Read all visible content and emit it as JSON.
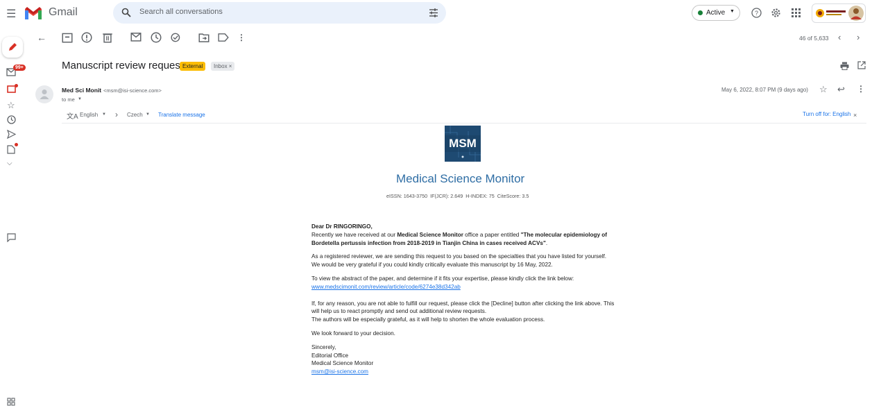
{
  "app": {
    "name": "Gmail"
  },
  "search": {
    "placeholder": "Search all conversations"
  },
  "status": {
    "label": "Active"
  },
  "toolbar": {
    "count": "46 of 5,633"
  },
  "rail": {
    "inbox_badge": "99+"
  },
  "message": {
    "subject": "Manuscript review request",
    "labels": [
      {
        "text": "External",
        "color": "#fbbc04"
      },
      {
        "text": "Inbox ×",
        "color": "#dadce0"
      }
    ],
    "sender_name": "Med Sci Monit",
    "sender_email": "<msm@isi-science.com>",
    "to": "to me",
    "date": "May 6, 2022, 8:07 PM (9 days ago)"
  },
  "translate": {
    "from": "English",
    "to": "Czech",
    "action": "Translate message",
    "turn_off": "Turn off for: English"
  },
  "journal": {
    "logo_text": "MSM",
    "name": "Medical Science Monitor",
    "metrics": "eISSN: 1643-3750  IF(JCR): 2.649  H-INDEX: 75  CiteScore: 3.5"
  },
  "body": {
    "greeting": "Dear Dr RINGORINGO,",
    "p1_a": "Recently we have received at our ",
    "p1_b": "Medical Science Monitor",
    "p1_c": " office a paper entitled ",
    "p1_d": "\"The molecular epidemiology of Bordetella pertussis infection from 2018-2019 in Tianjin China in cases received ACVs\"",
    "p1_e": ".",
    "p2_a": "As a registered reviewer, we are sending this request to you based on the specialties that you have listed for yourself.",
    "p2_b": "We would be very grateful if you could kindly critically evaluate this manuscript by 16 May, 2022.",
    "p3": "To view the abstract of the paper, and determine if it fits your expertise, please kindly click the link below:",
    "link": "www.medscimonit.com/review/article/code/6274e38d342ab",
    "p4_a": "If, for any reason, you are not able to fulfill our request, please click the [Decline] button after clicking the link above. This will help us to react promptly and send out additional review requests.",
    "p4_b": "The authors will be especially grateful, as it will help to shorten the whole evaluation process.",
    "p5": "We look forward to your decision.",
    "sig1": "Sincerely,",
    "sig2": "Editorial Office",
    "sig3": "Medical Science Monitor",
    "sig_email": "msm@isi-science.com"
  },
  "colors": {
    "accent": "#1a73e8",
    "logo_bg": "#1f4e79",
    "journal_title": "#2e6da4"
  }
}
